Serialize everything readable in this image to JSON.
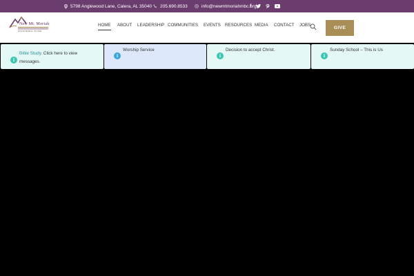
{
  "topbar": {
    "address": "5798 Anglewood Lane, Calera, AL 35040",
    "phone": "205.690.8533",
    "email": "info@newmtmoriahmbc.org",
    "social": [
      "f",
      "t",
      "p",
      "yt"
    ]
  },
  "logo": {
    "title": "New Mt. Moriah",
    "tagline": "We're On The Move... For Christ"
  },
  "nav": {
    "items": [
      "HOME",
      "ABOUT",
      "LEADERSHIP",
      "COMMUNITIES",
      "EVENTS",
      "RESOURCES",
      "MEDIA",
      "CONTACT",
      "JOBS"
    ],
    "active": "HOME",
    "give_label": "GIVE"
  },
  "cards": [
    {
      "prefix": "Bible Study.",
      "text": " Click here to view",
      "line2": "messages."
    },
    {
      "prefix": "",
      "text": "Worship Service",
      "line2": ""
    },
    {
      "prefix": "",
      "text": "Decision to accept Christ.",
      "line2": ""
    },
    {
      "prefix": "",
      "text": "Sunday School – This is Us",
      "line2": ""
    }
  ],
  "colors": {
    "topbar": "#6b3d6e",
    "give": "#a98e58",
    "card_mint": "#e4f8f5",
    "card_blue": "#dde9fb",
    "info_icon": "#3ec6b3",
    "info_icon_blue": "#3aa6d8"
  }
}
